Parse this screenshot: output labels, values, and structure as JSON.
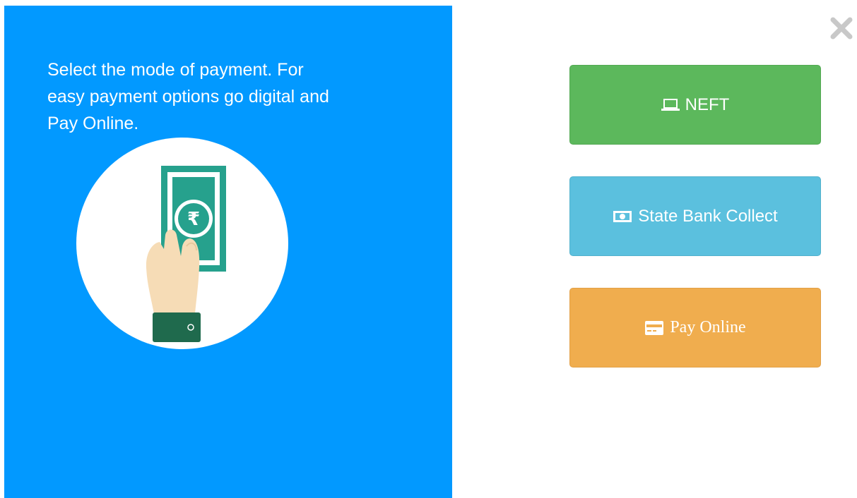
{
  "prompt": {
    "text": "Select the mode of payment. For easy payment options go digital and Pay Online."
  },
  "illustration": {
    "icon": "hand-holding-rupee-note",
    "currency_symbol": "₹"
  },
  "close": {
    "glyph": "✖",
    "icon": "close-icon"
  },
  "options": {
    "neft": {
      "label": "NEFT",
      "icon": "laptop-icon",
      "color": "#5cb85c"
    },
    "sbc": {
      "label": "State Bank Collect",
      "icon": "money-icon",
      "color": "#5bc0de"
    },
    "online": {
      "label": "Pay Online",
      "icon": "credit-card-icon",
      "color": "#f0ad4e"
    }
  },
  "colors": {
    "panel": "#0299ff",
    "note": "#26a18d",
    "cuff": "#1f6a4d",
    "hand": "#f6dcb6"
  }
}
